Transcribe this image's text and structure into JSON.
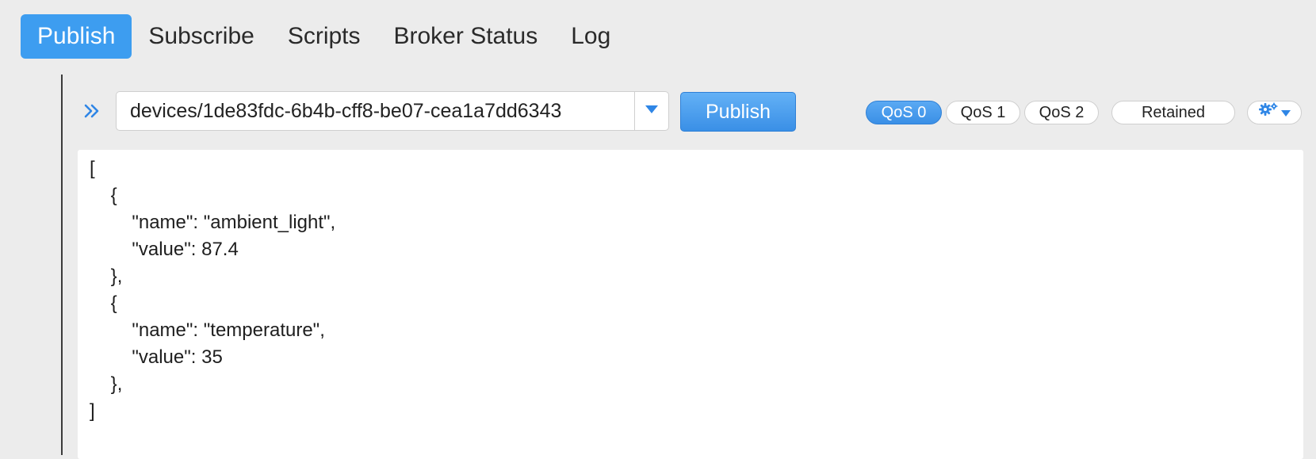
{
  "tabs": [
    {
      "label": "Publish",
      "active": true
    },
    {
      "label": "Subscribe",
      "active": false
    },
    {
      "label": "Scripts",
      "active": false
    },
    {
      "label": "Broker Status",
      "active": false
    },
    {
      "label": "Log",
      "active": false
    }
  ],
  "publish_bar": {
    "topic_value": "devices/1de83fdc-6b4b-cff8-be07-cea1a7dd6343",
    "publish_label": "Publish",
    "qos_options": [
      "QoS 0",
      "QoS 1",
      "QoS 2"
    ],
    "qos_selected": "QoS 0",
    "retained_label": "Retained",
    "icons": {
      "expand": "double-chevron-right-icon",
      "dropdown": "chevron-down-icon",
      "settings": "gear-icon"
    }
  },
  "payload": {
    "lines": [
      "[",
      "    {",
      "        \"name\": \"ambient_light\",",
      "        \"value\": 87.4",
      "    },",
      "    {",
      "        \"name\": \"temperature\",",
      "        \"value\": 35",
      "    },",
      "]"
    ]
  },
  "colors": {
    "accent": "#3d9df0",
    "background": "#ececec"
  }
}
